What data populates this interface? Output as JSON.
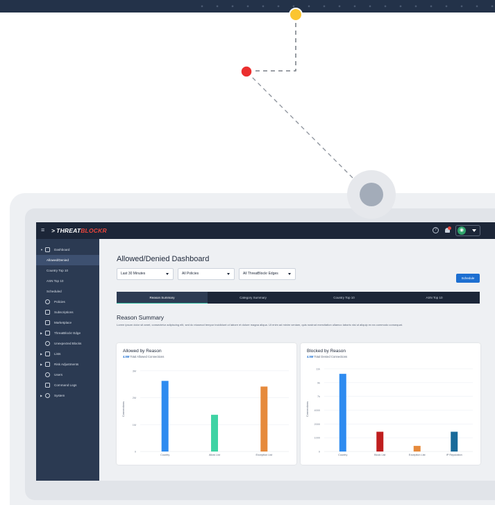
{
  "app": {
    "logo_prefix": "THREAT",
    "logo_accent": "BLOCKR"
  },
  "sidebar": {
    "items": [
      {
        "label": "Dashboard",
        "icon": "dashboard-icon",
        "expanded": true
      },
      {
        "label": "Allowed/Denied",
        "active": true
      },
      {
        "label": "Country Top 10"
      },
      {
        "label": "ASN Top 10"
      },
      {
        "label": "Scheduled"
      },
      {
        "label": "Policies",
        "icon": "policies-icon"
      },
      {
        "label": "Subscriptions",
        "icon": "subscriptions-icon"
      },
      {
        "label": "Marketplace",
        "icon": "marketplace-icon"
      },
      {
        "label": "ThreatBlockr Edge",
        "icon": "edge-icon"
      },
      {
        "label": "Unexpected Blocks",
        "icon": "unexpected-blocks-icon"
      },
      {
        "label": "Lists",
        "icon": "lists-icon"
      },
      {
        "label": "Risk Adjustments",
        "icon": "risk-adjustments-icon"
      },
      {
        "label": "Users",
        "icon": "users-icon"
      },
      {
        "label": "Command Logs",
        "icon": "command-logs-icon"
      },
      {
        "label": "System",
        "icon": "system-icon"
      }
    ]
  },
  "main": {
    "title": "Allowed/Denied Dashboard",
    "filters": {
      "time": "Last 30 Minutes",
      "policies": "All Policies",
      "edges": "All ThreatBlockr Edges"
    },
    "schedule_label": "Schedule",
    "tabs": [
      {
        "label": "Reason Summary",
        "active": true
      },
      {
        "label": "Category Summary"
      },
      {
        "label": "Country Top 10"
      },
      {
        "label": "ASN Top 10"
      }
    ],
    "section_title": "Reason Summary",
    "description": "Lorem ipsum dolor sit amet, consectetur adipiscing elit, sed do eiusmod tempor incididunt ut labore et dolore magna aliqua. Ut enim ad minim veniam, quis nostrud exercitation ullamco laboris nisi ut aliquip ex ea commodo consequat."
  },
  "cards": {
    "allowed": {
      "title": "Allowed by Reason",
      "total_value": "4.5M",
      "total_label": "Total Allowed Connections"
    },
    "blocked": {
      "title": "Blocked by Reason",
      "total_value": "4.5M",
      "total_label": "Total Denied Connections"
    }
  },
  "chart_data": [
    {
      "type": "bar",
      "categories": [
        "Country",
        "Allow List",
        "Exception List"
      ],
      "values": [
        2.5,
        1.3,
        2.3
      ],
      "colors": [
        "#2e8bf0",
        "#3fd3a4",
        "#e68a3c"
      ],
      "yticks": [
        "1M",
        "2M",
        "3M"
      ],
      "ytick_values": [
        1,
        2,
        3
      ],
      "ylim": [
        0,
        3
      ],
      "ylabel": "Connections",
      "grid": true
    },
    {
      "type": "bar",
      "categories": [
        "Country",
        "Block List",
        "Exception List",
        "IP Reputation"
      ],
      "values": [
        11000,
        2800,
        800,
        2800
      ],
      "colors": [
        "#2e8bf0",
        "#bf1e1e",
        "#e68a3c",
        "#1a6b9a"
      ],
      "yticks": [
        "1000",
        "2000",
        "4000",
        "7k",
        "9k",
        "11k"
      ],
      "ytick_values": [
        1000,
        2000,
        4000,
        7000,
        9000,
        11000
      ],
      "ytick_positions_note": "tick labels printed as shown",
      "ylim": [
        0,
        12000
      ],
      "ylabel": "Connections",
      "grid": true
    }
  ]
}
